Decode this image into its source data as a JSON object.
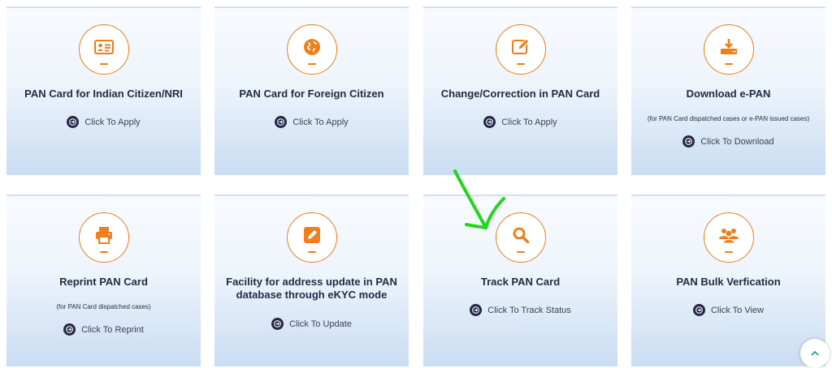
{
  "cards": [
    {
      "title": "PAN Card for Indian Citizen/NRI",
      "link": "Click To Apply",
      "icon": "id-card-icon"
    },
    {
      "title": "PAN Card for Foreign Citizen",
      "link": "Click To Apply",
      "icon": "globe-icon"
    },
    {
      "title": "Change/Correction in PAN Card",
      "link": "Click To Apply",
      "icon": "edit-icon"
    },
    {
      "title": "Download e-PAN",
      "note": "(for PAN Card dispatched cases or e-PAN issued cases)",
      "link": "Click To Download",
      "icon": "download-icon"
    },
    {
      "title": "Reprint PAN Card",
      "note": "(for PAN Card dispatched cases)",
      "link": "Click To Reprint",
      "icon": "printer-icon"
    },
    {
      "title": "Facility for address update in PAN database through eKYC mode",
      "link": "Click To Update",
      "icon": "pencil-icon"
    },
    {
      "title": "Track PAN Card",
      "link": "Click To Track Status",
      "icon": "search-icon"
    },
    {
      "title": "PAN Bulk Verfication",
      "link": "Click To View",
      "icon": "group-icon"
    }
  ],
  "colors": {
    "accent": "#ef7f1a",
    "dark": "#262748",
    "annotation": "#22d61e"
  }
}
